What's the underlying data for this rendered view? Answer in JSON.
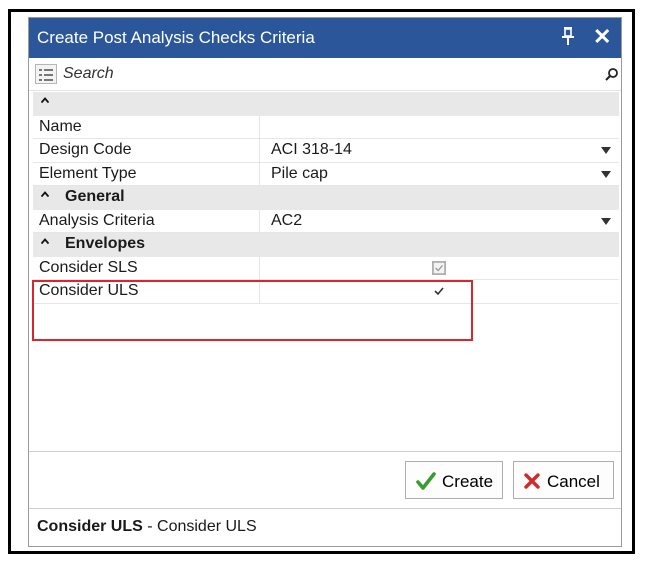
{
  "dialog": {
    "title": "Create Post Analysis Checks Criteria"
  },
  "search": {
    "placeholder": "Search"
  },
  "grid": {
    "rows": [
      {
        "type": "category",
        "label": ""
      },
      {
        "type": "property",
        "name": "Name",
        "value": ""
      },
      {
        "type": "property",
        "name": "Design Code",
        "value": "ACI 318-14",
        "dropdown": true
      },
      {
        "type": "property",
        "name": "Element Type",
        "value": "Pile cap",
        "dropdown": true
      },
      {
        "type": "category",
        "label": "General"
      },
      {
        "type": "property",
        "name": "Analysis Criteria",
        "value": "AC2",
        "dropdown": true
      },
      {
        "type": "category",
        "label": "Envelopes"
      },
      {
        "type": "checkbox",
        "name": "Consider SLS",
        "checked": true,
        "disabled": true
      },
      {
        "type": "checkbox",
        "name": "Consider ULS",
        "checked": true,
        "disabled": false
      }
    ]
  },
  "buttons": {
    "create": "Create",
    "cancel": "Cancel"
  },
  "description": {
    "title": "Consider ULS",
    "separator": " - ",
    "text": "Consider ULS"
  },
  "colors": {
    "titlebar": "#2b579a",
    "highlight": "#d9262c",
    "create_check": "#3a9c2e",
    "cancel_x": "#d02a2a"
  }
}
